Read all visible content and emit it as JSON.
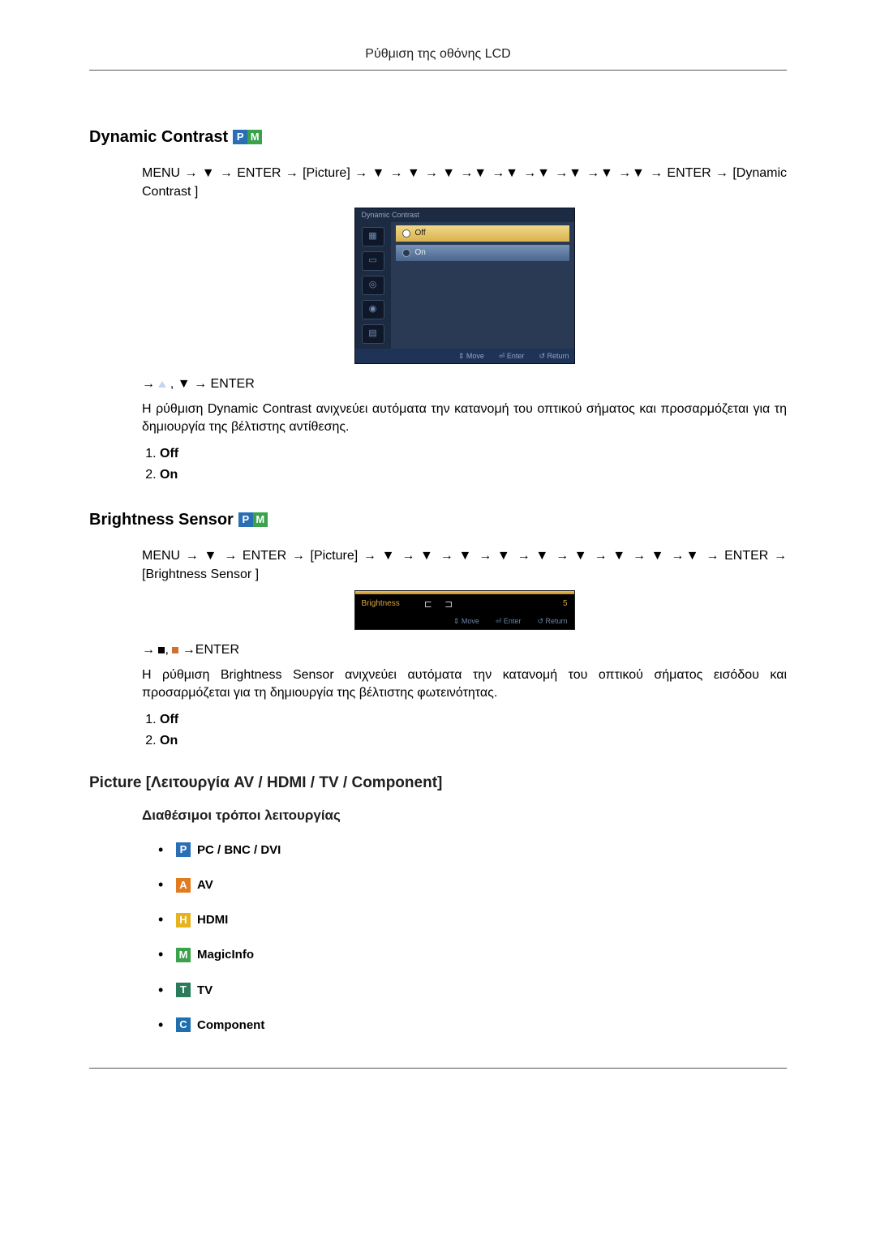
{
  "header": {
    "title": "Ρύθμιση της οθόνης LCD"
  },
  "sections": {
    "dynamic_contrast": {
      "title": "Dynamic Contrast",
      "nav_path": "MENU → ▼ → ENTER → [Picture] → ▼ → ▼ → ▼ →▼ →▼ →▼ →▼ →▼ →▼ → ENTER → [Dynamic Contrast ]",
      "nav_after": "→ ▲ , ▼ → ENTER",
      "description": "Η ρύθμιση Dynamic Contrast ανιχνεύει αυτόματα την κατανομή του οπτικού σήματος και προσαρμόζεται για τη δημιουργία της βέλτιστης αντίθεσης.",
      "options": [
        "Off",
        "On"
      ],
      "osd": {
        "title": "Dynamic Contrast",
        "items": [
          {
            "label": "Off",
            "selected": true
          },
          {
            "label": "On",
            "selected": false
          }
        ],
        "footer": [
          "Move",
          "Enter",
          "Return"
        ]
      }
    },
    "brightness_sensor": {
      "title": "Brightness Sensor",
      "nav_path": "MENU → ▼ → ENTER → [Picture] → ▼ → ▼ → ▼ → ▼ → ▼ → ▼ → ▼ → ▼ →▼ → ENTER → [Brightness Sensor ]",
      "nav_after": "→ ■, ■ →ENTER",
      "description": "Η ρύθμιση Brightness Sensor ανιχνεύει αυτόματα την κατανομή του οπτικού σήματος εισόδου και προσαρμόζεται για τη δημιουργία της βέλτιστης φωτεινότητας.",
      "options": [
        "Off",
        "On"
      ],
      "osd": {
        "label": "Brightness",
        "bracket": "⊏        ⊐",
        "value": "5",
        "footer": [
          "Move",
          "Enter",
          "Return"
        ]
      }
    },
    "picture_modes": {
      "title": "Picture [Λειτουργία AV / HDMI / TV / Component]",
      "subtitle": "Διαθέσιμοι τρόποι λειτουργίας",
      "modes": [
        {
          "badge": "P",
          "label": "PC / BNC / DVI"
        },
        {
          "badge": "A",
          "label": "AV"
        },
        {
          "badge": "H",
          "label": "HDMI"
        },
        {
          "badge": "M",
          "label": "MagicInfo"
        },
        {
          "badge": "T",
          "label": "TV"
        },
        {
          "badge": "C",
          "label": "Component"
        }
      ]
    }
  }
}
